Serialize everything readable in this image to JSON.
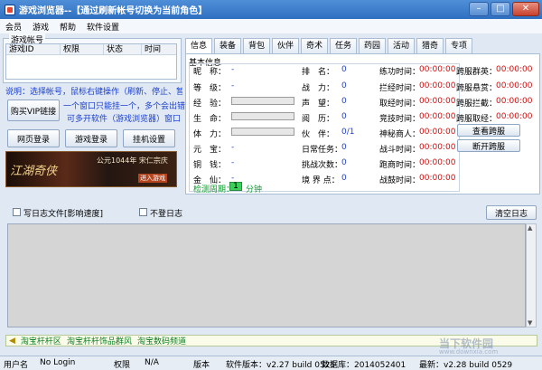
{
  "window": {
    "app_title": "游戏浏览器",
    "title_suffix": "--【通过刷新帐号切换为当前角色】",
    "buttons": {
      "minimize": "–",
      "maximize": "□",
      "close": "✕"
    }
  },
  "menu": [
    "会员",
    "游戏",
    "帮助",
    "软件设置"
  ],
  "account_group": {
    "title": "游戏帐号",
    "columns": [
      "游戏ID",
      "权限",
      "状态",
      "时间"
    ]
  },
  "help_text": {
    "line1": "说明：选择帐号，鼠标右键操作（刷新、停止、暂停）",
    "line2": "一个窗口只能挂一个，多个会出错",
    "line3": "可多开软件（游戏浏览器）窗口"
  },
  "buttons": {
    "buy_vip": "购买VIP链接",
    "web_login": "网页登录",
    "game_login": "游戏登录",
    "hook_settings": "挂机设置",
    "check_cross": "查看跨服",
    "disconnect_cross": "断开跨服",
    "clear_log": "清空日志"
  },
  "banner": {
    "logo_text": "江湖奇侠",
    "ad_text": "公元1044年 宋仁宗庆",
    "cta": "进入游戏"
  },
  "tabs": [
    "信息",
    "装备",
    "背包",
    "伙伴",
    "奇术",
    "任务",
    "药园",
    "活动",
    "猎奇",
    "专项"
  ],
  "info": {
    "group_title": "基本信息",
    "col1": [
      {
        "label": "昵",
        "label2": "称：",
        "value": "-"
      },
      {
        "label": "等",
        "label2": "级：",
        "value": "-"
      },
      {
        "label": "经",
        "label2": "验：",
        "gauge": 0
      },
      {
        "label": "生",
        "label2": "命：",
        "gauge": 0
      },
      {
        "label": "体",
        "label2": "力：",
        "gauge": 0
      },
      {
        "label": "元",
        "label2": "宝：",
        "value": "-"
      },
      {
        "label": "铜",
        "label2": "钱：",
        "value": "-"
      },
      {
        "label": "金",
        "label2": "仙：",
        "value": "-"
      }
    ],
    "col2": [
      {
        "label": "排　名：",
        "value": "0"
      },
      {
        "label": "战　力：",
        "value": "0"
      },
      {
        "label": "声　望：",
        "value": "0"
      },
      {
        "label": "阅　历：",
        "value": "0"
      },
      {
        "label": "伙　伴：",
        "value": "0/1"
      },
      {
        "label": "日常任务：",
        "value": "0"
      },
      {
        "label": "挑战次数：",
        "value": "0"
      },
      {
        "label": "境 界 点：",
        "value": "0"
      }
    ],
    "col3": [
      {
        "label": "练功时间：",
        "value": "00:00:00"
      },
      {
        "label": "拦经时间：",
        "value": "00:00:00"
      },
      {
        "label": "取经时间：",
        "value": "00:00:00"
      },
      {
        "label": "竞技时间：",
        "value": "00:00:00"
      },
      {
        "label": "神秘商人：",
        "value": "00:00:00"
      },
      {
        "label": "战斗时间：",
        "value": "00:00:00"
      },
      {
        "label": "跑商时间：",
        "value": "00:00:00"
      },
      {
        "label": "战鼓时间：",
        "value": "00:00:00"
      }
    ],
    "col4": [
      {
        "label": "跨服群英：",
        "value": "00:00:00"
      },
      {
        "label": "跨服悬赏：",
        "value": "00:00:00"
      },
      {
        "label": "跨服拦截：",
        "value": "00:00:00"
      },
      {
        "label": "跨服取经：",
        "value": "00:00:00"
      }
    ],
    "detect_label": "检测周期：",
    "detect_value": "1",
    "detect_unit": "分钟"
  },
  "log": {
    "write_log_label": "写日志文件[影响速度]",
    "no_log_label": "不登日志"
  },
  "links": [
    "淘宝杆杆区",
    "淘宝杆杆饰品群风",
    "淘宝数码频道"
  ],
  "watermark": {
    "cn": "当下软件园",
    "en": "www.downxia.com"
  },
  "status": {
    "user_label": "用户名",
    "user_value": "No Login",
    "perm_label": "权限",
    "perm_value": "N/A",
    "version_label": "版本",
    "software_version": "软件版本：v2.27 build 0525",
    "database": "数据库：2014052401",
    "latest": "最新：v2.28 build 0529"
  },
  "colors": {
    "title_bar": "#2f6fc0",
    "value_blue": "#1f42c9",
    "timer_red": "#d01010",
    "accent_green": "#0e9b2e"
  }
}
